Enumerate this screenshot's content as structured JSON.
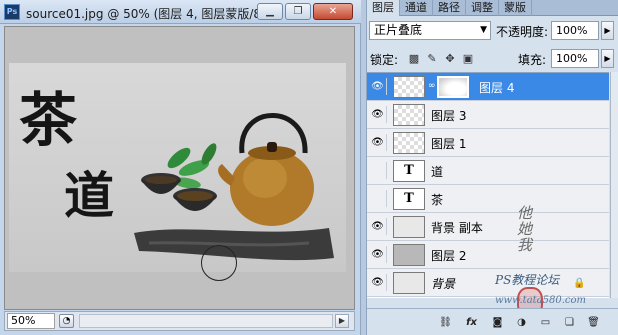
{
  "document": {
    "title": "source01.jpg @ 50% (图层 4, 图层蒙版/8) *",
    "app_icon": "Ps",
    "window_buttons": [
      "minimize-icon",
      "restore-icon",
      "close-icon"
    ],
    "zoom": "50%",
    "canvas_text": [
      "茶",
      "道"
    ]
  },
  "panel": {
    "tabs": [
      "图层",
      "通道",
      "路径",
      "调整",
      "蒙版"
    ],
    "active_tab": "图层",
    "blend_mode": "正片叠底",
    "opacity_label": "不透明度:",
    "opacity_value": "100%",
    "lock_label": "锁定:",
    "fill_label": "填充:",
    "fill_value": "100%",
    "layers": [
      {
        "name": "图层 4",
        "visible": true,
        "selected": true,
        "has_mask": true,
        "thumb": "checker"
      },
      {
        "name": "图层 3",
        "visible": true,
        "selected": false,
        "has_mask": false,
        "thumb": "checker"
      },
      {
        "name": "图层 1",
        "visible": true,
        "selected": false,
        "has_mask": false,
        "thumb": "checker"
      },
      {
        "name": "道",
        "visible": false,
        "selected": false,
        "has_mask": false,
        "thumb": "T"
      },
      {
        "name": "茶",
        "visible": false,
        "selected": false,
        "has_mask": false,
        "thumb": "T"
      },
      {
        "name": "背景 副本",
        "visible": true,
        "selected": false,
        "has_mask": false,
        "thumb": "image"
      },
      {
        "name": "图层 2",
        "visible": true,
        "selected": false,
        "has_mask": false,
        "thumb": "gray"
      },
      {
        "name": "背景",
        "visible": true,
        "selected": false,
        "has_mask": false,
        "thumb": "image",
        "locked": true
      }
    ],
    "bottom_icons": [
      "link-layers-icon",
      "layer-style-icon",
      "add-mask-icon",
      "adjustment-layer-icon",
      "new-group-icon",
      "new-layer-icon",
      "delete-layer-icon"
    ],
    "watermark_site": "www.tata580.com",
    "watermark_brand": "PS教程论坛"
  },
  "colors": {
    "selected_layer": "#3b89e6",
    "panel_bg": "#d6e1ee",
    "window_bg": "#c4d6ec"
  }
}
